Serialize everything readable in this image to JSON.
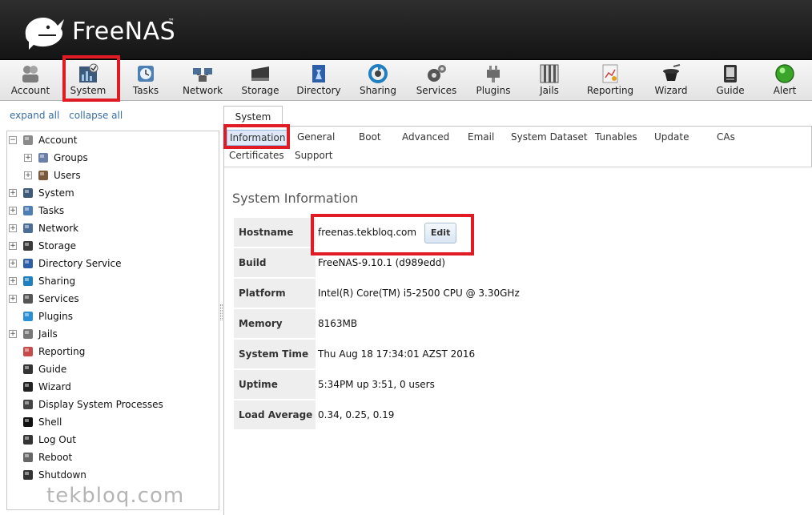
{
  "app": {
    "logo_text": "FreeNAS",
    "logo_tm": "™"
  },
  "toolbar": {
    "items": [
      {
        "label": "Account",
        "icon": "account-icon"
      },
      {
        "label": "System",
        "icon": "system-icon"
      },
      {
        "label": "Tasks",
        "icon": "tasks-icon"
      },
      {
        "label": "Network",
        "icon": "network-icon"
      },
      {
        "label": "Storage",
        "icon": "storage-icon"
      },
      {
        "label": "Directory",
        "icon": "directory-icon"
      },
      {
        "label": "Sharing",
        "icon": "sharing-icon"
      },
      {
        "label": "Services",
        "icon": "services-icon"
      },
      {
        "label": "Plugins",
        "icon": "plugins-icon"
      },
      {
        "label": "Jails",
        "icon": "jails-icon"
      },
      {
        "label": "Reporting",
        "icon": "reporting-icon"
      },
      {
        "label": "Wizard",
        "icon": "wizard-icon"
      },
      {
        "label": "Guide",
        "icon": "guide-icon"
      },
      {
        "label": "Alert",
        "icon": "alert-icon"
      }
    ]
  },
  "sidebar": {
    "expand_all": "expand all",
    "collapse_all": "collapse all",
    "tree": [
      {
        "label": "Account",
        "expander": "−",
        "icon": "account-icon"
      },
      {
        "label": "Groups",
        "expander": "+",
        "icon": "groups-icon"
      },
      {
        "label": "Users",
        "expander": "+",
        "icon": "users-icon"
      },
      {
        "label": "System",
        "expander": "+",
        "icon": "system-icon"
      },
      {
        "label": "Tasks",
        "expander": "+",
        "icon": "tasks-icon"
      },
      {
        "label": "Network",
        "expander": "+",
        "icon": "network-icon"
      },
      {
        "label": "Storage",
        "expander": "+",
        "icon": "storage-icon"
      },
      {
        "label": "Directory Service",
        "expander": "+",
        "icon": "directory-icon"
      },
      {
        "label": "Sharing",
        "expander": "+",
        "icon": "sharing-icon"
      },
      {
        "label": "Services",
        "expander": "+",
        "icon": "services-icon"
      },
      {
        "label": "Plugins",
        "expander": "",
        "icon": "plugins-icon"
      },
      {
        "label": "Jails",
        "expander": "+",
        "icon": "jails-icon"
      },
      {
        "label": "Reporting",
        "expander": "",
        "icon": "reporting-icon"
      },
      {
        "label": "Guide",
        "expander": "",
        "icon": "guide-icon"
      },
      {
        "label": "Wizard",
        "expander": "",
        "icon": "wizard-icon"
      },
      {
        "label": "Display System Processes",
        "expander": "",
        "icon": "processes-icon"
      },
      {
        "label": "Shell",
        "expander": "",
        "icon": "shell-icon"
      },
      {
        "label": "Log Out",
        "expander": "",
        "icon": "logout-icon"
      },
      {
        "label": "Reboot",
        "expander": "",
        "icon": "reboot-icon"
      },
      {
        "label": "Shutdown",
        "expander": "",
        "icon": "shutdown-icon"
      }
    ]
  },
  "main": {
    "top_tab": "System",
    "subtabs": [
      {
        "label": "Information",
        "active": true
      },
      {
        "label": "General"
      },
      {
        "label": "Boot"
      },
      {
        "label": "Advanced"
      },
      {
        "label": "Email"
      },
      {
        "label": "System Dataset"
      },
      {
        "label": "Tunables"
      },
      {
        "label": "Update"
      },
      {
        "label": "CAs"
      },
      {
        "label": "Certificates"
      },
      {
        "label": "Support"
      }
    ],
    "section_title": "System Information",
    "info": [
      {
        "key": "Hostname",
        "value": "freenas.tekbloq.com",
        "edit_label": "Edit"
      },
      {
        "key": "Build",
        "value": "FreeNAS-9.10.1 (d989edd)"
      },
      {
        "key": "Platform",
        "value": "Intel(R) Core(TM) i5-2500 CPU @ 3.30GHz"
      },
      {
        "key": "Memory",
        "value": "8163MB"
      },
      {
        "key": "System Time",
        "value": "Thu Aug 18 17:34:01 AZST 2016"
      },
      {
        "key": "Uptime",
        "value": "5:34PM up 3:51, 0 users"
      },
      {
        "key": "Load Average",
        "value": "0.34, 0.25, 0.19"
      }
    ]
  },
  "watermark": "tekbloq.com",
  "colors": {
    "highlight": "#e01b24",
    "link": "#3a6ea5",
    "active_tab_bg": "#dfe8f6"
  }
}
